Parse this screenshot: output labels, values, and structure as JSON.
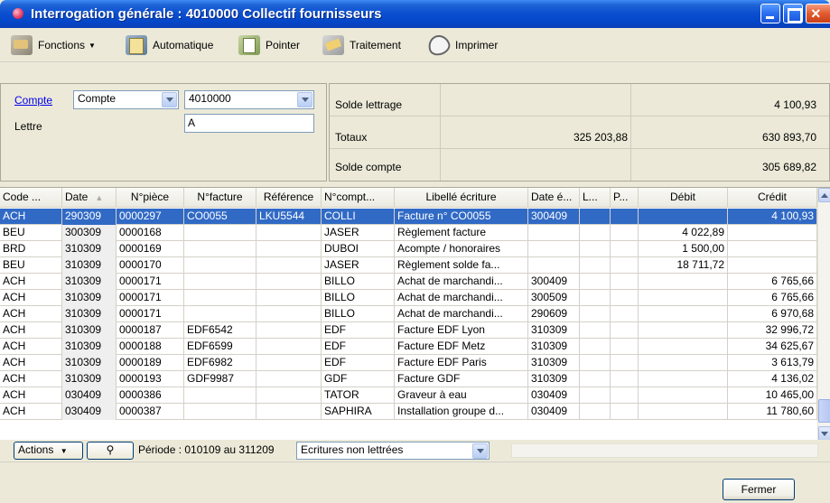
{
  "window": {
    "title": "Interrogation générale :  4010000 Collectif fournisseurs"
  },
  "toolbar": {
    "fonctions": "Fonctions",
    "automatique": "Automatique",
    "pointer": "Pointer",
    "traitement": "Traitement",
    "imprimer": "Imprimer"
  },
  "filter": {
    "compte_link": "Compte",
    "compte_type_value": "Compte",
    "compte_value": "4010000",
    "lettre_label": "Lettre",
    "lettre_value": "A"
  },
  "summary": {
    "solde_lettrage_label": "Solde lettrage",
    "solde_lettrage_value": "4 100,93",
    "totaux_label": "Totaux",
    "totaux_debit": "325 203,88",
    "totaux_credit": "630 893,70",
    "solde_compte_label": "Solde compte",
    "solde_compte_value": "305 689,82"
  },
  "grid": {
    "headers": [
      "Code ...",
      "Date",
      "N°pièce",
      "N°facture",
      "Référence",
      "N°compt...",
      "Libellé écriture",
      "Date é...",
      "L...",
      "P...",
      "Débit",
      "Crédit"
    ],
    "rows": [
      {
        "code": "ACH",
        "date": "290309",
        "piece": "0000297",
        "facture": "CO0055",
        "reference": "LKU5544",
        "compte": "COLLI",
        "libelle": "Facture n° CO0055",
        "date_ech": "300409",
        "l": "",
        "p": "",
        "debit": "",
        "credit": "4 100,93"
      },
      {
        "code": "BEU",
        "date": "300309",
        "piece": "0000168",
        "facture": "",
        "reference": "",
        "compte": "JASER",
        "libelle": "Règlement facture",
        "date_ech": "",
        "l": "",
        "p": "",
        "debit": "4 022,89",
        "credit": ""
      },
      {
        "code": "BRD",
        "date": "310309",
        "piece": "0000169",
        "facture": "",
        "reference": "",
        "compte": "DUBOI",
        "libelle": "Acompte / honoraires",
        "date_ech": "",
        "l": "",
        "p": "",
        "debit": "1 500,00",
        "credit": ""
      },
      {
        "code": "BEU",
        "date": "310309",
        "piece": "0000170",
        "facture": "",
        "reference": "",
        "compte": "JASER",
        "libelle": "Règlement solde fa...",
        "date_ech": "",
        "l": "",
        "p": "",
        "debit": "18 711,72",
        "credit": ""
      },
      {
        "code": "ACH",
        "date": "310309",
        "piece": "0000171",
        "facture": "",
        "reference": "",
        "compte": "BILLO",
        "libelle": "Achat de marchandi...",
        "date_ech": "300409",
        "l": "",
        "p": "",
        "debit": "",
        "credit": "6 765,66"
      },
      {
        "code": "ACH",
        "date": "310309",
        "piece": "0000171",
        "facture": "",
        "reference": "",
        "compte": "BILLO",
        "libelle": "Achat de marchandi...",
        "date_ech": "300509",
        "l": "",
        "p": "",
        "debit": "",
        "credit": "6 765,66"
      },
      {
        "code": "ACH",
        "date": "310309",
        "piece": "0000171",
        "facture": "",
        "reference": "",
        "compte": "BILLO",
        "libelle": "Achat de marchandi...",
        "date_ech": "290609",
        "l": "",
        "p": "",
        "debit": "",
        "credit": "6 970,68"
      },
      {
        "code": "ACH",
        "date": "310309",
        "piece": "0000187",
        "facture": "EDF6542",
        "reference": "",
        "compte": "EDF",
        "libelle": "Facture EDF Lyon",
        "date_ech": "310309",
        "l": "",
        "p": "",
        "debit": "",
        "credit": "32 996,72"
      },
      {
        "code": "ACH",
        "date": "310309",
        "piece": "0000188",
        "facture": "EDF6599",
        "reference": "",
        "compte": "EDF",
        "libelle": "Facture EDF Metz",
        "date_ech": "310309",
        "l": "",
        "p": "",
        "debit": "",
        "credit": "34 625,67"
      },
      {
        "code": "ACH",
        "date": "310309",
        "piece": "0000189",
        "facture": "EDF6982",
        "reference": "",
        "compte": "EDF",
        "libelle": "Facture EDF Paris",
        "date_ech": "310309",
        "l": "",
        "p": "",
        "debit": "",
        "credit": "3 613,79"
      },
      {
        "code": "ACH",
        "date": "310309",
        "piece": "0000193",
        "facture": "GDF9987",
        "reference": "",
        "compte": "GDF",
        "libelle": "Facture GDF",
        "date_ech": "310309",
        "l": "",
        "p": "",
        "debit": "",
        "credit": "4 136,02"
      },
      {
        "code": "ACH",
        "date": "030409",
        "piece": "0000386",
        "facture": "",
        "reference": "",
        "compte": "TATOR",
        "libelle": "Graveur à eau",
        "date_ech": "030409",
        "l": "",
        "p": "",
        "debit": "",
        "credit": "10 465,00"
      },
      {
        "code": "ACH",
        "date": "030409",
        "piece": "0000387",
        "facture": "",
        "reference": "",
        "compte": "SAPHIRA",
        "libelle": "Installation groupe d...",
        "date_ech": "030409",
        "l": "",
        "p": "",
        "debit": "",
        "credit": "11 780,60"
      }
    ]
  },
  "status": {
    "actions": "Actions",
    "periode": "Période : 010109 au 311209",
    "filter_value": "Ecritures non lettrées"
  },
  "buttons": {
    "fermer": "Fermer"
  },
  "colors": {
    "selection": "#316ac5",
    "titlebar": "#0a4ed0",
    "window_bg": "#ece9d8"
  }
}
